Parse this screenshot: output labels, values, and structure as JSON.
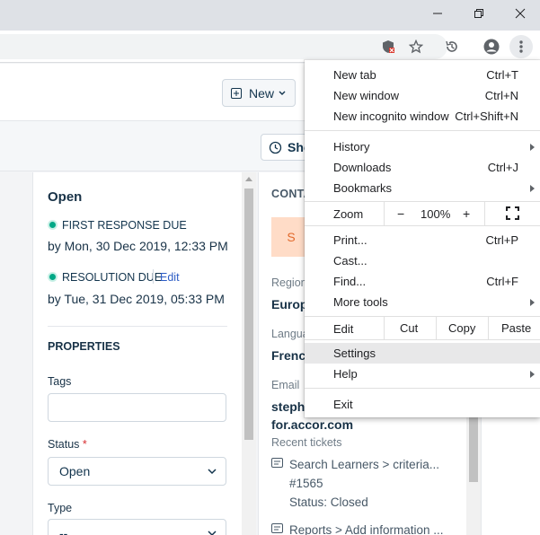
{
  "browser": {
    "window_controls": [
      "minimize",
      "restore",
      "close"
    ],
    "toolbar_icons": [
      "blocked-extension-icon",
      "star-icon",
      "history-icon",
      "profile-icon",
      "kebab-menu-icon"
    ]
  },
  "app": {
    "header": {
      "new_button": "New"
    },
    "subbar": {
      "show_button": "Sho"
    },
    "ticket": {
      "status": "Open",
      "first_response_label": "FIRST RESPONSE DUE",
      "first_response_date": "by Mon, 30 Dec 2019, 12:33 PM",
      "resolution_label": "RESOLUTION DUE",
      "resolution_edit": "Edit",
      "resolution_date": "by Tue, 31 Dec 2019, 05:33 PM",
      "status_color": "#00a886"
    },
    "properties": {
      "heading": "PROPERTIES",
      "tags_label": "Tags",
      "tags_value": "",
      "status_label": "Status",
      "status_required": "*",
      "status_value": "Open",
      "type_label": "Type",
      "type_value": "--"
    },
    "contact": {
      "heading": "CONTA",
      "avatar_letter": "S",
      "region_label": "Region",
      "region_value": "Europ",
      "language_label": "Langua",
      "language_value": "Frencl",
      "email_label": "Email",
      "email_line1": "stepha",
      "email_line2": "for.accor.com",
      "recent_label": "Recent tickets",
      "tickets": [
        {
          "title": "Search Learners > criteria...",
          "number": "#1565",
          "status": "Status: Closed"
        },
        {
          "title": "Reports > Add information ...",
          "number": "",
          "status": ""
        }
      ]
    }
  },
  "menu": {
    "items_top": [
      {
        "label": "New tab",
        "shortcut": "Ctrl+T"
      },
      {
        "label": "New window",
        "shortcut": "Ctrl+N"
      },
      {
        "label": "New incognito window",
        "shortcut": "Ctrl+Shift+N"
      }
    ],
    "items_mid": [
      {
        "label": "History",
        "shortcut": ""
      },
      {
        "label": "Downloads",
        "shortcut": "Ctrl+J"
      },
      {
        "label": "Bookmarks",
        "shortcut": ""
      }
    ],
    "zoom": {
      "label": "Zoom",
      "minus": "−",
      "value": "100%",
      "plus": "+"
    },
    "items_tools": [
      {
        "label": "Print...",
        "shortcut": "Ctrl+P"
      },
      {
        "label": "Cast...",
        "shortcut": ""
      },
      {
        "label": "Find...",
        "shortcut": "Ctrl+F"
      },
      {
        "label": "More tools",
        "shortcut": ""
      }
    ],
    "edit": {
      "label": "Edit",
      "cut": "Cut",
      "copy": "Copy",
      "paste": "Paste"
    },
    "settings": "Settings",
    "help": "Help",
    "exit": "Exit"
  }
}
